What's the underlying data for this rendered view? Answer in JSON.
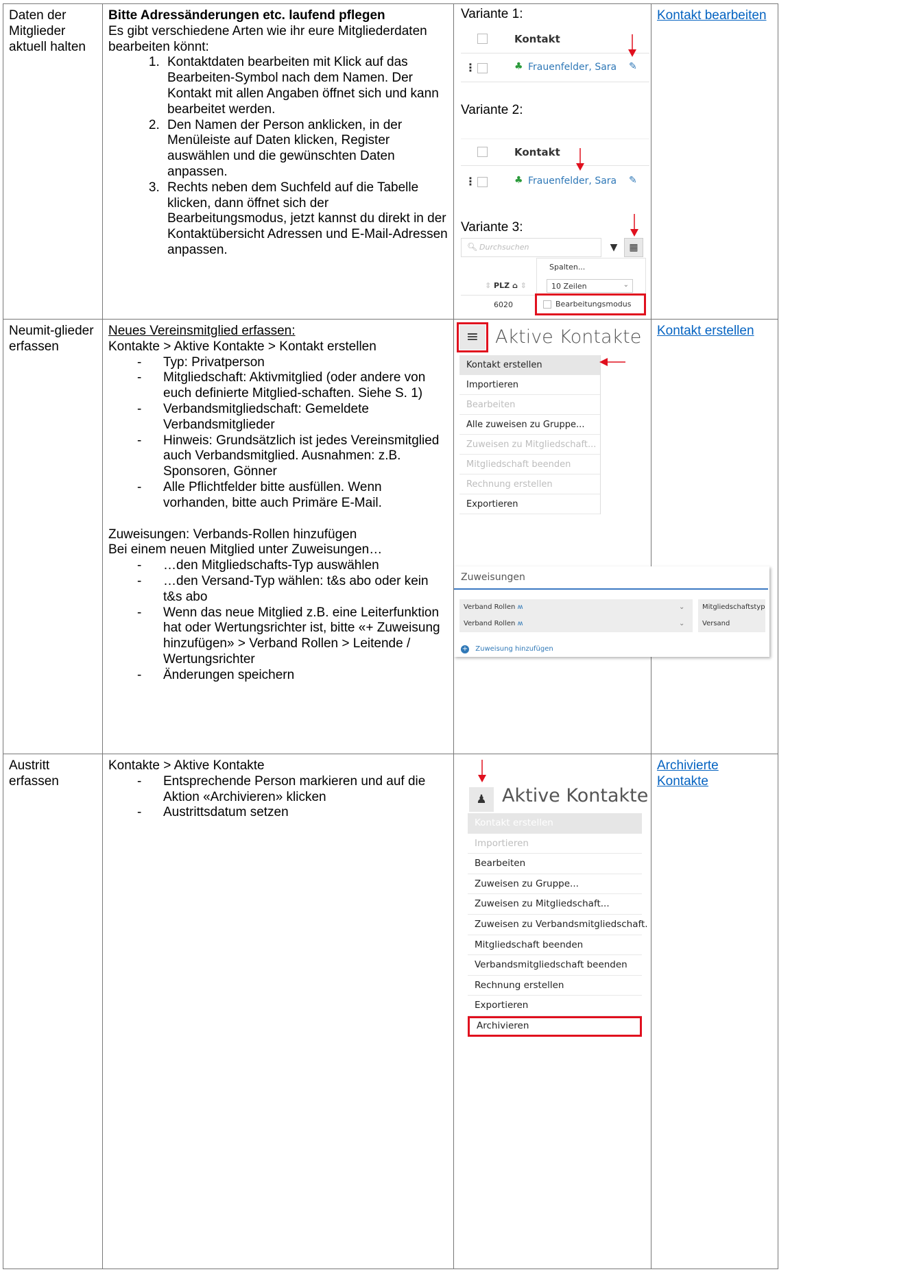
{
  "row1": {
    "label": "Daten der Mitglieder aktuell halten",
    "title": "Bitte Adressänderungen etc. laufend pflegen",
    "intro": "Es gibt verschiedene Arten wie ihr eure Mitgliederdaten bearbeiten könnt:",
    "steps": [
      "Kontaktdaten bearbeiten mit Klick auf das Bearbeiten-Symbol nach dem Namen. Der Kontakt mit allen Angaben öffnet sich und kann bearbeitet werden.",
      "Den Namen der Person anklicken, in der Menüleiste auf Daten klicken, Register auswählen und die gewünschten Daten anpassen.",
      "Rechts neben dem Suchfeld auf die Tabelle klicken, dann öffnet sich der Bearbeitungsmodus, jetzt kannst du direkt in der Kontaktübersicht Adressen und E-Mail-Adressen anpassen."
    ],
    "variant1": "Variante 1:",
    "variant2": "Variante 2:",
    "variant3": "Variante 3:",
    "col_header": "Kontakt",
    "person": "Frauenfelder, Sara",
    "search_placeholder": "Durchsuchen",
    "spalten": "Spalten...",
    "zeilen": "10 Zeilen",
    "plz": "PLZ",
    "plz_value": "6020",
    "bearbeitungsmodus": "Bearbeitungsmodus",
    "link": "Kontakt bearbeiten"
  },
  "row2": {
    "label": "Neumit-glieder erfassen",
    "heading": "Neues Vereinsmitglied erfassen:",
    "path": "Kontakte > Aktive Kontakte > Kontakt erstellen",
    "items": [
      "Typ: Privatperson",
      "Mitgliedschaft: Aktivmitglied (oder andere von euch definierte Mitglied-schaften. Siehe S. 1)",
      "Verbandsmitgliedschaft: Gemeldete Verbandsmitglieder",
      "Hinweis: Grundsätzlich ist jedes Vereinsmitglied auch Verbandsmitglied. Ausnahmen: z.B. Sponsoren, Gönner",
      "Alle Pflichtfelder bitte ausfüllen. Wenn vorhanden, bitte auch Primäre E-Mail."
    ],
    "zuweisungen_title": "Zuweisungen: Verbands-Rollen hinzufügen",
    "zuweisungen_intro": "Bei einem neuen Mitglied unter Zuweisungen…",
    "zuweisungen_items": [
      "…den Mitgliedschafts-Typ auswählen",
      "…den Versand-Typ wählen: t&s abo oder kein t&s abo",
      "Wenn das neue Mitglied z.B. eine Leiterfunktion hat oder Wertungsrichter ist, bitte «+ Zuweisung hinzufügen» > Verband Rollen > Leitende / Wertungsrichter",
      "Änderungen speichern"
    ],
    "shot_title": "Aktive Kontakte",
    "menu": [
      {
        "label": "Kontakt erstellen",
        "state": "active"
      },
      {
        "label": "Importieren",
        "state": "normal"
      },
      {
        "label": "Bearbeiten",
        "state": "disabled"
      },
      {
        "label": "Alle zuweisen zu Gruppe...",
        "state": "normal"
      },
      {
        "label": "Zuweisen zu Mitgliedschaft...",
        "state": "disabled"
      },
      {
        "label": "Mitgliedschaft beenden",
        "state": "disabled"
      },
      {
        "label": "Rechnung erstellen",
        "state": "disabled"
      },
      {
        "label": "Exportieren",
        "state": "normal"
      }
    ],
    "zw_panel_title": "Zuweisungen",
    "zw_rows": [
      {
        "left": "Verband Rollen",
        "right": "Mitgliedschaftstyp"
      },
      {
        "left": "Verband Rollen",
        "right": "Versand"
      }
    ],
    "zw_add": "Zuweisung hinzufügen",
    "link": "Kontakt erstellen"
  },
  "row3": {
    "label": "Austritt erfassen",
    "path": "Kontakte > Aktive Kontakte",
    "items": [
      "Entsprechende Person markieren und auf die Aktion «Archivieren» klicken",
      "Austrittsdatum setzen"
    ],
    "shot_title": "Aktive Kontakte",
    "menu": [
      {
        "label": "Kontakt erstellen",
        "state": "header"
      },
      {
        "label": "Importieren",
        "state": "disabled"
      },
      {
        "label": "Bearbeiten",
        "state": "normal"
      },
      {
        "label": "Zuweisen zu Gruppe...",
        "state": "normal"
      },
      {
        "label": "Zuweisen zu Mitgliedschaft...",
        "state": "normal"
      },
      {
        "label": "Zuweisen zu Verbandsmitgliedschaft.",
        "state": "normal"
      },
      {
        "label": "Mitgliedschaft beenden",
        "state": "normal"
      },
      {
        "label": "Verbandsmitgliedschaft beenden",
        "state": "normal"
      },
      {
        "label": "Rechnung erstellen",
        "state": "normal"
      },
      {
        "label": "Exportieren",
        "state": "normal"
      },
      {
        "label": "Archivieren",
        "state": "highlight"
      }
    ],
    "link": "Archivierte Kontakte"
  },
  "colors": {
    "link": "#0563c1",
    "highlight": "#e0101e",
    "arrow": "#e0101e"
  },
  "icons": [
    "arrow-down-icon",
    "arrow-left-icon",
    "edit-icon",
    "person-icon",
    "filter-icon",
    "table-icon",
    "hamburger-icon",
    "user-icon",
    "plus-circle-icon",
    "search-icon"
  ]
}
